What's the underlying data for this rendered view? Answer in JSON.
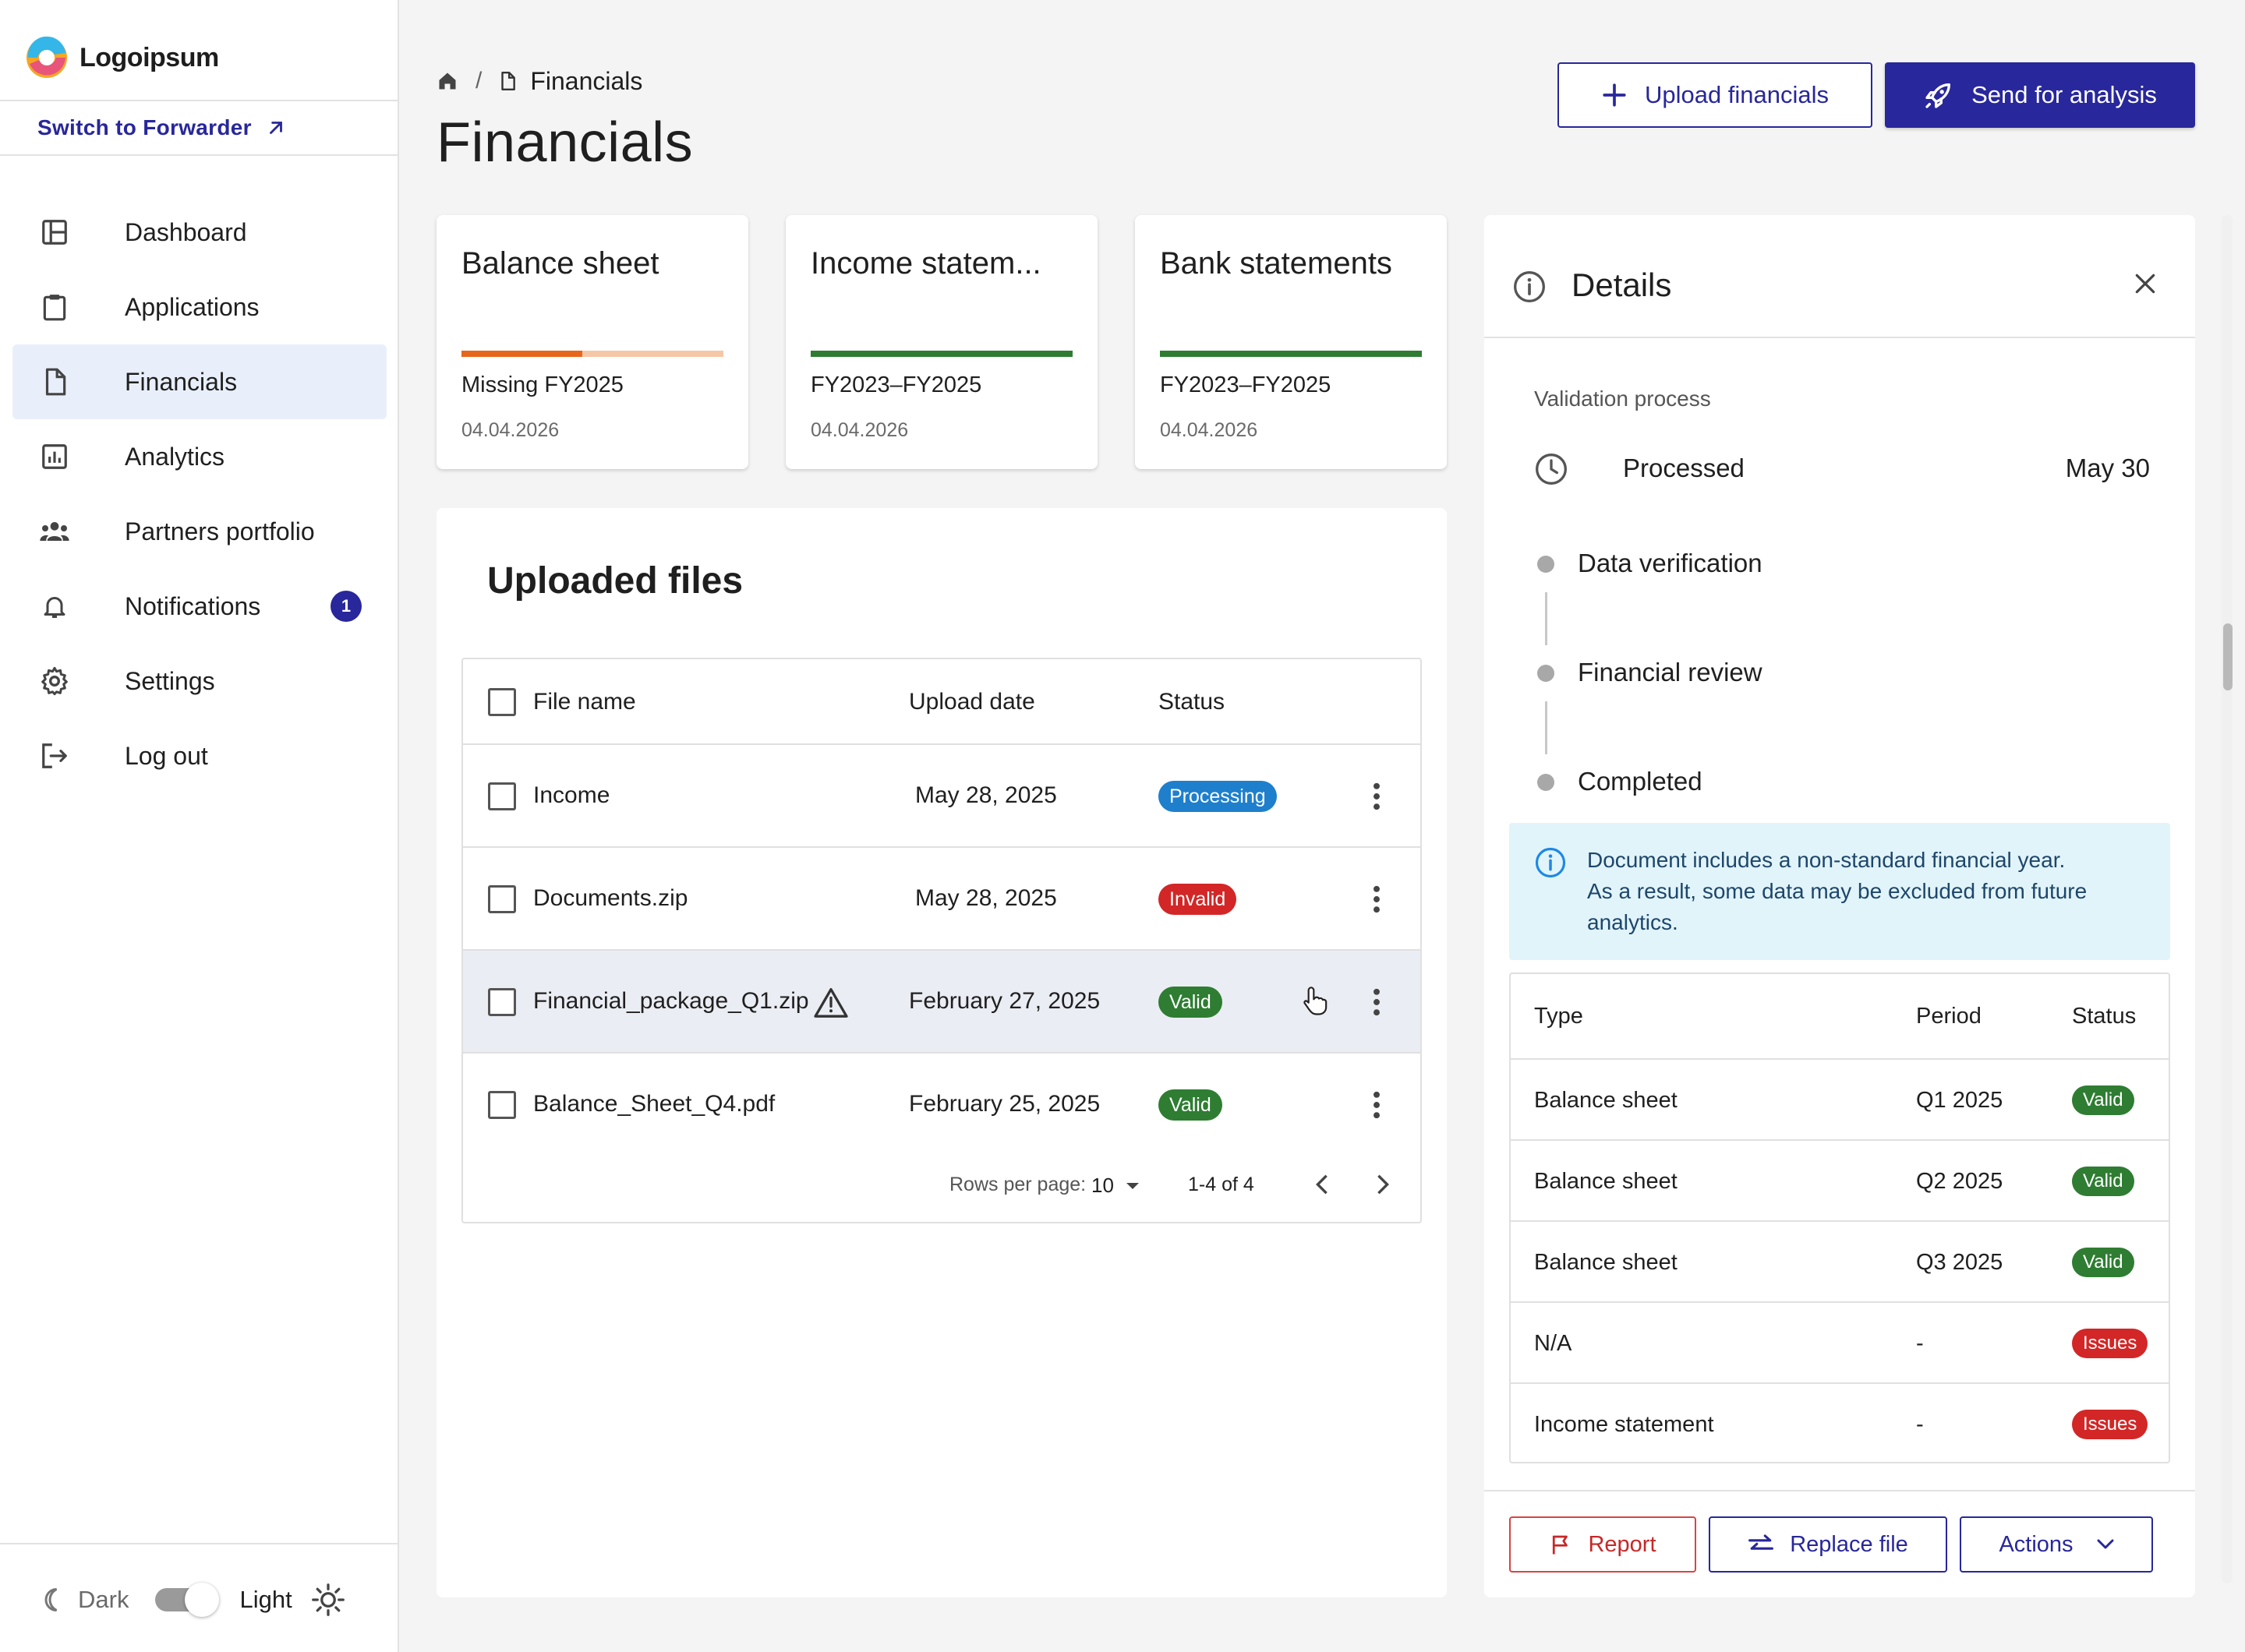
{
  "app": {
    "logo_text": "Logoipsum",
    "switch_link": "Switch to Forwarder",
    "accent": "#28279b"
  },
  "sidebar": {
    "items": [
      {
        "label": "Dashboard",
        "icon": "dashboard-icon"
      },
      {
        "label": "Applications",
        "icon": "clipboard-icon"
      },
      {
        "label": "Financials",
        "icon": "document-icon",
        "active": true
      },
      {
        "label": "Analytics",
        "icon": "bar-chart-icon"
      },
      {
        "label": "Partners portfolio",
        "icon": "people-icon"
      },
      {
        "label": "Notifications",
        "icon": "bell-icon",
        "badge": "1"
      },
      {
        "label": "Settings",
        "icon": "gear-icon"
      },
      {
        "label": "Log out",
        "icon": "logout-icon"
      }
    ],
    "theme": {
      "dark_label": "Dark",
      "light_label": "Light",
      "selected": "Light"
    }
  },
  "header": {
    "breadcrumb_sep": "/",
    "breadcrumb_page": "Financials",
    "title": "Financials",
    "upload_label": "Upload financials",
    "send_label": "Send for analysis"
  },
  "cards": [
    {
      "title": "Balance sheet",
      "line1": "Missing FY2025",
      "line2": "04.04.2026",
      "progress": 0.46,
      "color": "#e8651c",
      "track": "#f6c7a6"
    },
    {
      "title": "Income statem...",
      "line1": "FY2023–FY2025",
      "line2": "04.04.2026",
      "progress": 1.0,
      "color": "#2e7d32",
      "track": "#2e7d32"
    },
    {
      "title": "Bank statements",
      "line1": "FY2023–FY2025",
      "line2": "04.04.2026",
      "progress": 1.0,
      "color": "#2e7d32",
      "track": "#2e7d32"
    }
  ],
  "files": {
    "title": "Uploaded files",
    "columns": {
      "name": "File name",
      "date": "Upload date",
      "status": "Status"
    },
    "rows": [
      {
        "name": "Income",
        "date": "May 28, 2025",
        "status": "Processing",
        "status_color": "#1e7fcc"
      },
      {
        "name": "Documents.zip",
        "date": "May 28, 2025",
        "status": "Invalid",
        "status_color": "#d32626"
      },
      {
        "name": "Financial_package_Q1.zip",
        "date": "February 27, 2025",
        "status": "Valid",
        "status_color": "#2e7d32",
        "warning": true,
        "hovered": true
      },
      {
        "name": "Balance_Sheet_Q4.pdf",
        "date": "February 25, 2025",
        "status": "Valid",
        "status_color": "#2e7d32"
      }
    ],
    "pager": {
      "rows_label": "Rows per page:",
      "rows_value": "10",
      "range": "1-4 of 4"
    }
  },
  "details": {
    "title": "Details",
    "validation_label": "Validation process",
    "processed_label": "Processed",
    "processed_date": "May 30",
    "steps": [
      "Data verification",
      "Financial review",
      "Completed"
    ],
    "alert_line1": "Document includes a non-standard financial year.",
    "alert_line2": "As a result, some data may be excluded from future analytics.",
    "columns": {
      "type": "Type",
      "period": "Period",
      "status": "Status"
    },
    "rows": [
      {
        "type": "Balance sheet",
        "period": "Q1 2025",
        "status": "Valid",
        "status_color": "#2e7d32"
      },
      {
        "type": "Balance sheet",
        "period": "Q2 2025",
        "status": "Valid",
        "status_color": "#2e7d32"
      },
      {
        "type": "Balance sheet",
        "period": "Q3 2025",
        "status": "Valid",
        "status_color": "#2e7d32"
      },
      {
        "type": "N/A",
        "period": "-",
        "status": "Issues",
        "status_color": "#d32626"
      },
      {
        "type": "Income statement",
        "period": "-",
        "status": "Issues",
        "status_color": "#d32626"
      }
    ],
    "report_label": "Report",
    "replace_label": "Replace file",
    "actions_label": "Actions"
  }
}
